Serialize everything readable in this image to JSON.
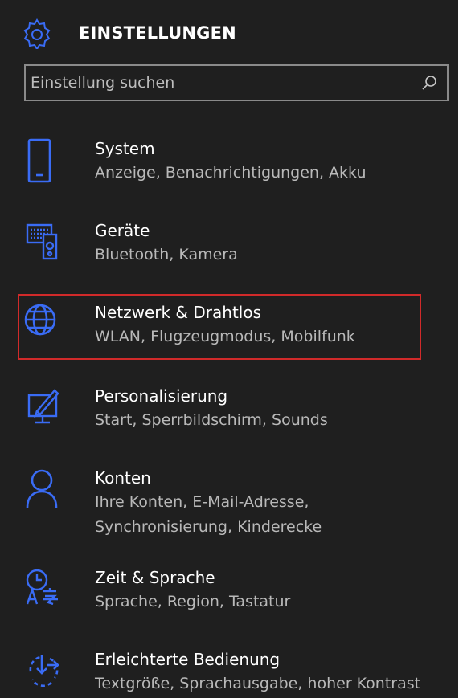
{
  "header": {
    "title": "EINSTELLUNGEN",
    "icon": "gear-icon"
  },
  "search": {
    "placeholder": "Einstellung suchen",
    "icon": "search-icon"
  },
  "colors": {
    "background": "#1f1f1f",
    "accent": "#3a6cf5",
    "highlight_border": "#d12a2a",
    "secondary_text": "#b9b9b9"
  },
  "items": [
    {
      "label": "System",
      "desc": "Anzeige, Benachrichtigungen, Akku",
      "icon": "phone-icon"
    },
    {
      "label": "Geräte",
      "desc": "Bluetooth, Kamera",
      "icon": "devices-icon"
    },
    {
      "label": "Netzwerk & Drahtlos",
      "desc": "WLAN, Flugzeugmodus, Mobilfunk",
      "icon": "globe-icon",
      "highlighted": true
    },
    {
      "label": "Personalisierung",
      "desc": "Start, Sperrbildschirm, Sounds",
      "icon": "personalize-icon"
    },
    {
      "label": "Konten",
      "desc": "Ihre Konten, E-Mail-Adresse, Synchronisierung, Kinderecke",
      "icon": "person-icon"
    },
    {
      "label": "Zeit & Sprache",
      "desc": "Sprache, Region, Tastatur",
      "icon": "time-language-icon"
    },
    {
      "label": "Erleichterte Bedienung",
      "desc": "Textgröße, Sprachausgabe, hoher Kontrast",
      "icon": "ease-of-access-icon"
    }
  ]
}
